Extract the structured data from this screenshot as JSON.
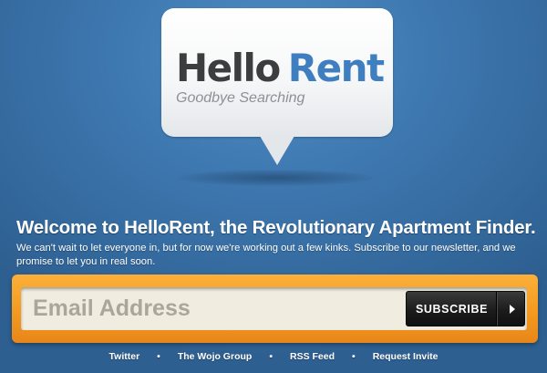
{
  "logo": {
    "word_hello": "Hello",
    "word_rent": "Rent",
    "tagline": "Goodbye Searching",
    "colors": {
      "hello": "#3b3d3f",
      "rent": "#3f7fc0"
    }
  },
  "welcome": {
    "headline": "Welcome to HelloRent, the Revolutionary Apartment Finder.",
    "body": "We can't wait to let everyone in, but for now we're working out a few kinks. Subscribe to our newsletter, and we promise to let you in real soon."
  },
  "subscribe": {
    "placeholder": "Email Address",
    "value": "",
    "button_label": "SUBSCRIBE",
    "button_icon": "arrow-right-icon",
    "colors": {
      "bar": "#f39a1f",
      "button": "#1c1c1c"
    }
  },
  "footer": {
    "separator": "•",
    "links": [
      "Twitter",
      "The Wojo Group",
      "RSS Feed",
      "Request Invite"
    ]
  },
  "colors": {
    "background": "#3a72a8",
    "text": "#ffffff"
  }
}
